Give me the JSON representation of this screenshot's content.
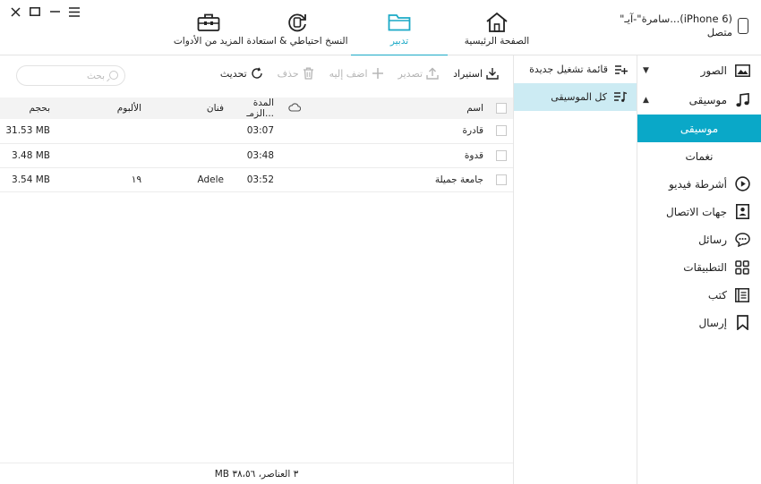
{
  "window": {
    "controls": [
      "close-icon",
      "maximize-icon",
      "minimize-icon",
      "menu-icon"
    ]
  },
  "device": {
    "name": "\"سامرة\"-آيـ...(iPhone 6)",
    "status": "متصل"
  },
  "tabs": [
    {
      "label": "المزيد من الأدوات",
      "icon": "toolbox-icon"
    },
    {
      "label": "النسخ احتياطي & استعادة",
      "icon": "backup-restore-icon"
    },
    {
      "label": "تدبير",
      "icon": "folder-icon",
      "active": true
    },
    {
      "label": "الصفحة الرئيسية",
      "icon": "home-icon"
    }
  ],
  "nav": {
    "photos": "الصور",
    "music": "موسيقى",
    "music_sub_active": "موسيقى",
    "ringtones": "نغمات",
    "videos": "أشرطة فيديو",
    "contacts": "جهات الاتصال",
    "messages": "رسائل",
    "apps": "التطبيقات",
    "books": "كتب",
    "send": "إرسال"
  },
  "playlists": {
    "new_playlist": "قائمة تشغيل جديدة",
    "all_music": "كل الموسيقى"
  },
  "toolbar": {
    "import": "استيراد",
    "export": "تصدير",
    "add_to": "اضف إليه",
    "delete": "حذف",
    "refresh": "تحديث",
    "search_placeholder": "بحث"
  },
  "table": {
    "headers": {
      "name": "اسم",
      "duration": "المدة الزمـ...",
      "artist": "فنان",
      "album": "الألبوم",
      "size": "بحجم"
    },
    "rows": [
      {
        "name": "قادرة",
        "duration": "03:07",
        "artist": "",
        "album": "",
        "size": "31.53 MB"
      },
      {
        "name": "قدوة",
        "duration": "03:48",
        "artist": "",
        "album": "",
        "size": "3.48 MB"
      },
      {
        "name": "جامعة جميلة",
        "duration": "03:52",
        "artist": "Adele",
        "album": "١٩",
        "size": "3.54 MB"
      }
    ]
  },
  "status": {
    "summary": "٣ العناصر، ٣٨،٥٦ MB"
  },
  "colors": {
    "accent": "#1aa9c6",
    "nav_active_bg": "#0aa8c8",
    "playlist_selected_bg": "#ccebf3"
  }
}
